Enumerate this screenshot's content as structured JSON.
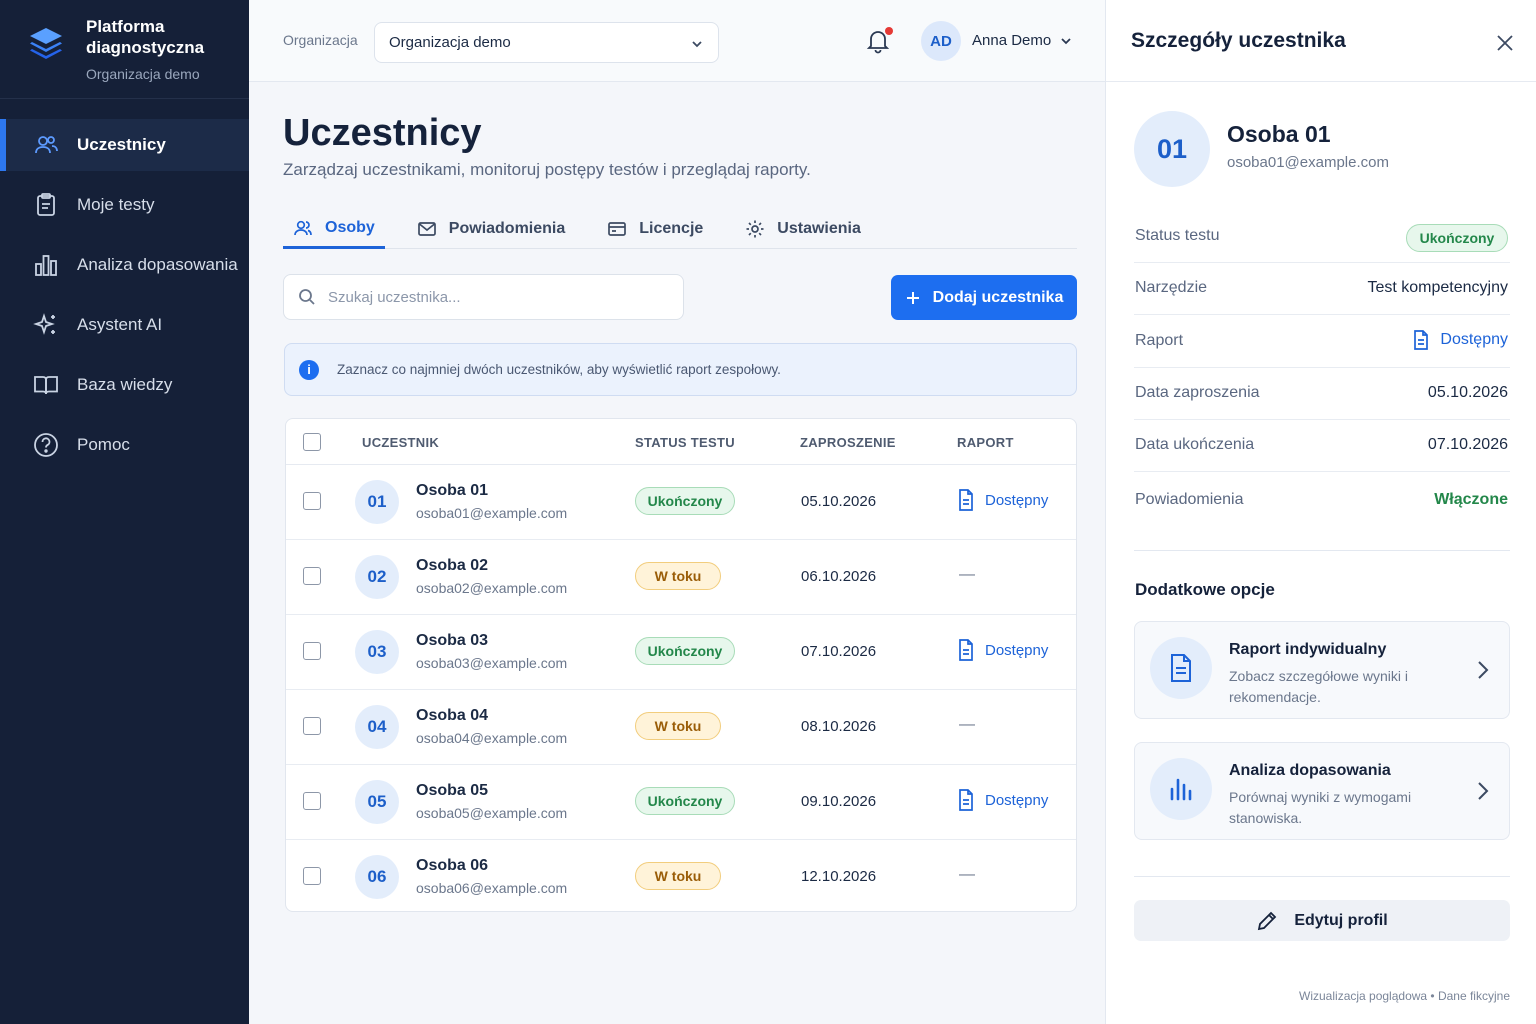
{
  "brand": {
    "title": "Platforma diagnostyczna",
    "subtitle": "Organizacja demo"
  },
  "sidebar": {
    "items": [
      {
        "label": "Uczestnicy",
        "icon": "users-icon",
        "active": true
      },
      {
        "label": "Moje testy",
        "icon": "clipboard-icon"
      },
      {
        "label": "Analiza dopasowania",
        "icon": "bar-chart-icon"
      },
      {
        "label": "Asystent AI",
        "icon": "sparkles-icon"
      },
      {
        "label": "Baza wiedzy",
        "icon": "book-icon"
      },
      {
        "label": "Pomoc",
        "icon": "help-circle-icon"
      }
    ]
  },
  "topbar": {
    "org_label": "Organizacja",
    "org_value": "Organizacja demo",
    "user_initials": "AD",
    "user_name": "Anna Demo"
  },
  "page": {
    "title": "Uczestnicy",
    "subtitle": "Zarządzaj uczestnikami, monitoruj postępy testów i przeglądaj raporty."
  },
  "tabs": [
    {
      "label": "Osoby",
      "icon": "users-icon",
      "active": true
    },
    {
      "label": "Powiadomienia",
      "icon": "mail-icon"
    },
    {
      "label": "Licencje",
      "icon": "card-icon"
    },
    {
      "label": "Ustawienia",
      "icon": "gear-icon"
    }
  ],
  "search": {
    "placeholder": "Szukaj uczestnika..."
  },
  "add_button": "Dodaj uczestnika",
  "info": "Zaznacz co najmniej dwóch uczestników, aby wyświetlić raport zespołowy.",
  "table": {
    "headers": {
      "participant": "UCZESTNIK",
      "status": "STATUS TESTU",
      "invitation": "ZAPROSZENIE",
      "report": "RAPORT"
    },
    "rows": [
      {
        "num": "01",
        "name": "Osoba 01",
        "email": "osoba01@example.com",
        "status": "Ukończony",
        "status_kind": "done",
        "date": "05.10.2026",
        "report": "Dostępny"
      },
      {
        "num": "02",
        "name": "Osoba 02",
        "email": "osoba02@example.com",
        "status": "W toku",
        "status_kind": "prog",
        "date": "06.10.2026",
        "report": "—"
      },
      {
        "num": "03",
        "name": "Osoba 03",
        "email": "osoba03@example.com",
        "status": "Ukończony",
        "status_kind": "done",
        "date": "07.10.2026",
        "report": "Dostępny"
      },
      {
        "num": "04",
        "name": "Osoba 04",
        "email": "osoba04@example.com",
        "status": "W toku",
        "status_kind": "prog",
        "date": "08.10.2026",
        "report": "—"
      },
      {
        "num": "05",
        "name": "Osoba 05",
        "email": "osoba05@example.com",
        "status": "Ukończony",
        "status_kind": "done",
        "date": "09.10.2026",
        "report": "Dostępny"
      },
      {
        "num": "06",
        "name": "Osoba 06",
        "email": "osoba06@example.com",
        "status": "W toku",
        "status_kind": "prog",
        "date": "12.10.2026",
        "report": "—"
      }
    ]
  },
  "panel": {
    "title": "Szczegóły uczestnika",
    "num": "01",
    "name": "Osoba 01",
    "email": "osoba01@example.com",
    "details": {
      "status_label": "Status testu",
      "status_value": "Ukończony",
      "tool_label": "Narzędzie",
      "tool_value": "Test kompetencyjny",
      "report_label": "Raport",
      "report_value": "Dostępny",
      "invite_label": "Data zaproszenia",
      "invite_value": "05.10.2026",
      "complete_label": "Data ukończenia",
      "complete_value": "07.10.2026",
      "notif_label": "Powiadomienia",
      "notif_value": "Włączone"
    },
    "options_title": "Dodatkowe opcje",
    "options": [
      {
        "title": "Raport indywidualny",
        "desc": "Zobacz szczegółowe wyniki i rekomendacje.",
        "icon": "document-icon"
      },
      {
        "title": "Analiza dopasowania",
        "desc": "Porównaj wyniki z wymogami stanowiska.",
        "icon": "bar-chart-icon"
      }
    ],
    "edit_button": "Edytuj profil",
    "footnote": "Wizualizacja poglądowa • Dane fikcyjne"
  },
  "colors": {
    "accent": "#1d6ef0",
    "sidebar_bg": "#152038",
    "success": "#23874a",
    "warning": "#9a5d08"
  }
}
